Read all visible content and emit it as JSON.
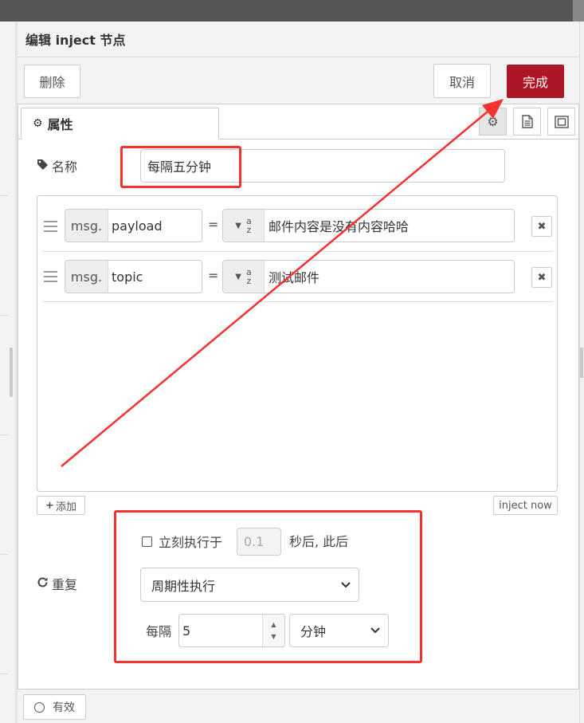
{
  "window": {
    "title": "编辑 inject 节点"
  },
  "toolbar": {
    "delete_label": "删除",
    "cancel_label": "取消",
    "done_label": "完成"
  },
  "tabs": [
    {
      "label": "属性",
      "icon": "gear-icon"
    }
  ],
  "tab_tools": [
    "gear-icon",
    "document-icon",
    "frame-icon"
  ],
  "form": {
    "name_label": "名称",
    "name_value": "每隔五分钟",
    "properties": [
      {
        "prefix": "msg.",
        "key": "payload",
        "equals": "=",
        "type_top": "a",
        "type_bottom": "z",
        "value": "邮件内容是没有内容哈哈"
      },
      {
        "prefix": "msg.",
        "key": "topic",
        "equals": "=",
        "type_top": "a",
        "type_bottom": "z",
        "value": "测试邮件"
      }
    ],
    "add_label": "添加",
    "inject_now_label": "inject now",
    "immediate_label": "立刻执行于",
    "immediate_delay": "0.1",
    "immediate_after": "秒后, 此后",
    "repeat_label": "重复",
    "repeat_mode": "周期性执行",
    "every_label": "每隔",
    "interval_value": "5",
    "interval_unit": "分钟"
  },
  "footer": {
    "enabled_label": "有效"
  },
  "colors": {
    "primary": "#ad1625",
    "annotation": "#f43230"
  }
}
